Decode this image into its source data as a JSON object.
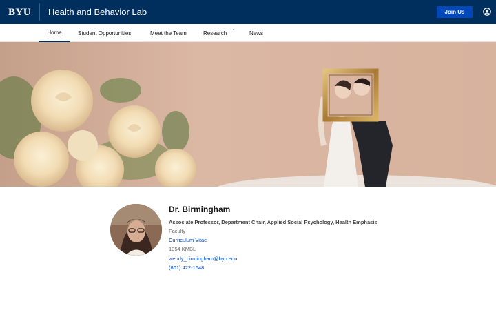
{
  "header": {
    "logo": "BYU",
    "site_title": "Health and Behavior Lab",
    "join_label": "Join Us",
    "user_icon": "user-circle-icon"
  },
  "nav": {
    "items": [
      {
        "label": "Home",
        "active": true
      },
      {
        "label": "Student Opportunities"
      },
      {
        "label": "Meet the Team"
      },
      {
        "label": "Research",
        "has_dropdown": true
      },
      {
        "label": "News"
      }
    ]
  },
  "hero": {
    "image": "wedding cake topper couple holding gold frame beside cream roses"
  },
  "profile": {
    "name": "Dr. Birmingham",
    "title": "Associate Professor, Department Chair, Applied Social Psychology, Health Emphasis",
    "role": "Faculty",
    "cv_label": "Curriculum Vitae",
    "office": "1054 KMBL",
    "email": "wendy_birmingham@byu.edu",
    "phone": "(801) 422-1648"
  },
  "colors": {
    "header_bg": "#002e5d",
    "button_bg": "#0047ba",
    "link": "#0047ba"
  }
}
